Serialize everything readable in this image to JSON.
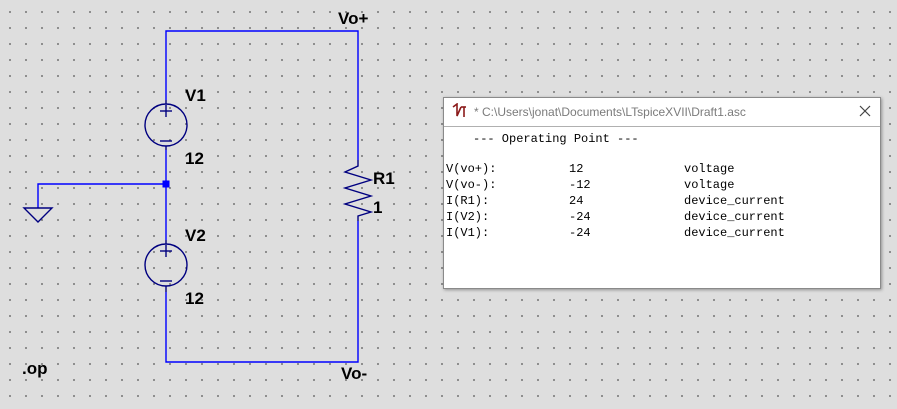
{
  "schematic": {
    "nets": {
      "top": "Vo+",
      "bottom": "Vo-"
    },
    "components": [
      {
        "ref": "V1",
        "value": "12",
        "kind": "voltage-source"
      },
      {
        "ref": "V2",
        "value": "12",
        "kind": "voltage-source"
      },
      {
        "ref": "R1",
        "value": "1",
        "kind": "resistor"
      }
    ],
    "directive": ".op",
    "colors": {
      "wire": "#0000ff",
      "component": "#000080",
      "junction": "#0000ff",
      "ground": "#000080",
      "background": "#dedede"
    }
  },
  "op_window": {
    "title": "* C:\\Users\\jonat\\Documents\\LTspiceXVII\\Draft1.asc",
    "app_icon": "ltspice-icon",
    "close_icon": "close-icon",
    "header": "--- Operating Point ---",
    "rows": [
      {
        "name": "V(vo+):",
        "value": "12",
        "type": "voltage"
      },
      {
        "name": "V(vo-):",
        "value": "-12",
        "type": "voltage"
      },
      {
        "name": "I(R1):",
        "value": "24",
        "type": "device_current"
      },
      {
        "name": "I(V2):",
        "value": "-24",
        "type": "device_current"
      },
      {
        "name": "I(V1):",
        "value": "-24",
        "type": "device_current"
      }
    ]
  }
}
